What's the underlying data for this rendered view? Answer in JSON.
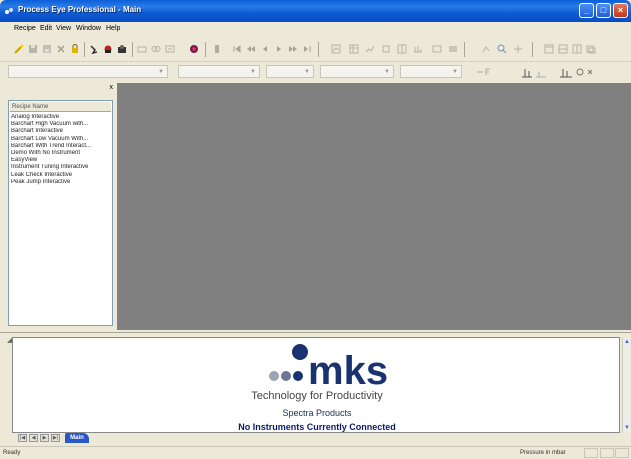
{
  "window": {
    "title": "Process Eye Professional - Main",
    "buttons": {
      "minimize": "_",
      "maximize": "□",
      "close": "×"
    }
  },
  "menu": [
    "Recipe",
    "Edit",
    "View",
    "Window",
    "Help"
  ],
  "toolbar": {
    "icons": [
      "wand-icon",
      "save-icon",
      "save-as-icon",
      "delete-icon",
      "lock-icon",
      "run-icon",
      "record-icon",
      "stop-icon",
      "link-icon",
      "unlink-icon",
      "config-icon",
      "instrument-icon",
      "skip-icon",
      "first-icon",
      "prev-icon",
      "rewind-icon",
      "play-icon",
      "forward-icon",
      "last-icon",
      "chart-icon",
      "table-icon",
      "trend-icon",
      "view-icon",
      "grid-icon",
      "layout-icon",
      "zoom-fit-icon",
      "bars-icon",
      "cursor-icon",
      "zoom-icon",
      "window-icon",
      "tile-icon",
      "cascade-icon",
      "refresh-icon"
    ]
  },
  "left_panel": {
    "close_label": "x",
    "header": "Recipe Name",
    "recipes": [
      "Analog Interactive",
      "Barchart High Vacuum with...",
      "Barchart Interactive",
      "Barchart Low Vacuum With...",
      "Barchart With Trend Interact...",
      "Demo With No Instrument",
      "EasyView",
      "Instrument Tuning Interactive",
      "Leak Check Interactive",
      "Peak Jump Interactive"
    ]
  },
  "bottom_pane": {
    "brand": "mks",
    "tagline": "Technology for Productivity",
    "product_line": "Spectra Products",
    "status_message": "No Instruments Currently Connected",
    "tab_label": "Main"
  },
  "status_bar": {
    "left": "Ready",
    "right": "Pressure in mbar"
  }
}
